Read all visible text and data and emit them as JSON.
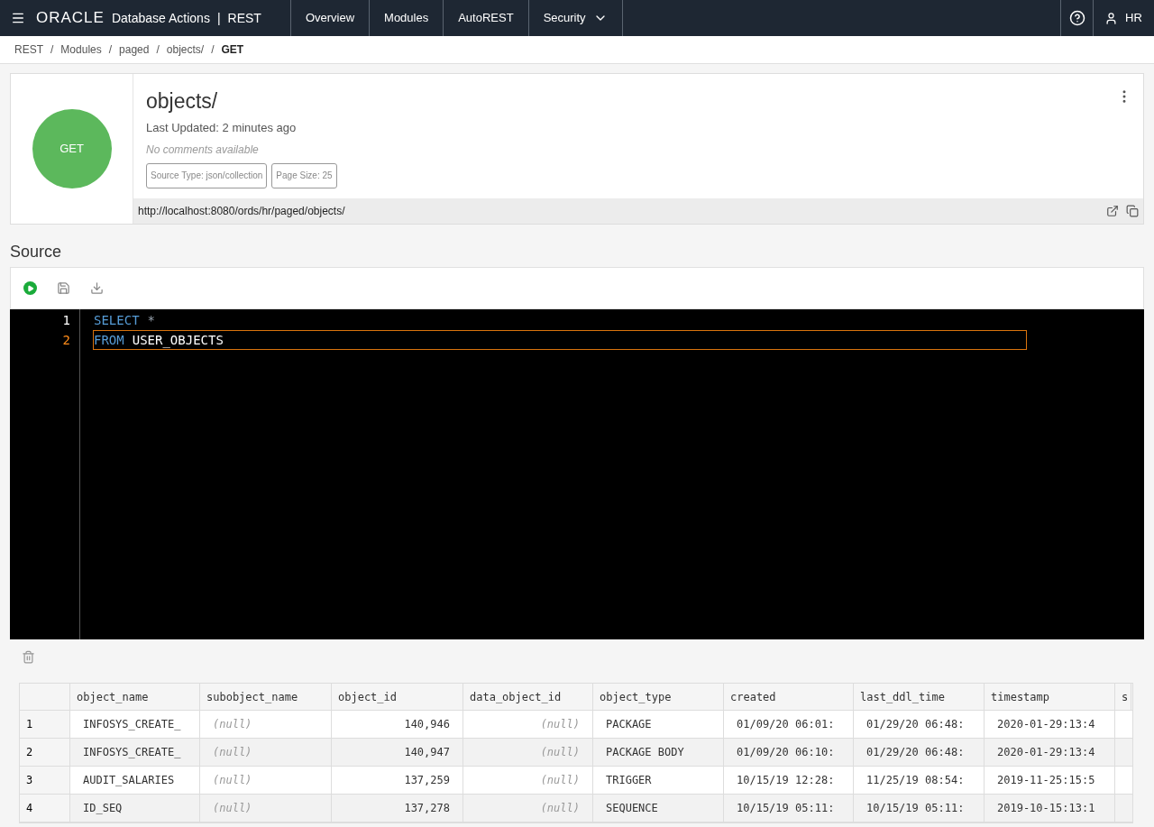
{
  "header": {
    "brand": "ORACLE",
    "app": "Database Actions",
    "separator": "|",
    "section": "REST",
    "nav": [
      {
        "label": "Overview",
        "has_menu": false
      },
      {
        "label": "Modules",
        "has_menu": false
      },
      {
        "label": "AutoREST",
        "has_menu": false
      },
      {
        "label": "Security",
        "has_menu": true
      }
    ],
    "user": "HR"
  },
  "breadcrumb": {
    "separator": "/",
    "items": [
      {
        "label": "REST",
        "current": false
      },
      {
        "label": "Modules",
        "current": false
      },
      {
        "label": "paged",
        "current": false
      },
      {
        "label": "objects/",
        "current": false
      },
      {
        "label": "GET",
        "current": true
      }
    ]
  },
  "handler": {
    "method": "GET",
    "title": "objects/",
    "updated": "Last Updated: 2 minutes ago",
    "comments": "No comments available",
    "tags": [
      "Source Type: json/collection",
      "Page Size: 25"
    ],
    "url": "http://localhost:8080/ords/hr/paged/objects/"
  },
  "source": {
    "heading": "Source",
    "lines": [
      {
        "number": "1",
        "current": false,
        "tokens": [
          {
            "kind": "keyword",
            "text": "SELECT"
          },
          {
            "kind": "operator",
            "text": "*"
          }
        ]
      },
      {
        "number": "2",
        "current": true,
        "tokens": [
          {
            "kind": "keyword",
            "text": "FROM"
          },
          {
            "kind": "ident",
            "text": "USER_OBJECTS"
          }
        ]
      }
    ]
  },
  "table": {
    "columns": [
      "object_name",
      "subobject_name",
      "object_id",
      "data_object_id",
      "object_type",
      "created",
      "last_ddl_time",
      "timestamp",
      "s"
    ],
    "rows": [
      {
        "number": "1",
        "cells": [
          "INFOSYS_CREATE_",
          "(null)",
          "140,946",
          "(null)",
          "PACKAGE",
          "01/09/20 06:01:",
          "01/29/20 06:48:",
          "2020-01-29:13:4"
        ]
      },
      {
        "number": "2",
        "cells": [
          "INFOSYS_CREATE_",
          "(null)",
          "140,947",
          "(null)",
          "PACKAGE BODY",
          "01/09/20 06:10:",
          "01/29/20 06:48:",
          "2020-01-29:13:4"
        ]
      },
      {
        "number": "3",
        "cells": [
          "AUDIT_SALARIES",
          "(null)",
          "137,259",
          "(null)",
          "TRIGGER",
          "10/15/19 12:28:",
          "11/25/19 08:54:",
          "2019-11-25:15:5"
        ]
      },
      {
        "number": "4",
        "cells": [
          "ID_SEQ",
          "(null)",
          "137,278",
          "(null)",
          "SEQUENCE",
          "10/15/19 05:11:",
          "10/15/19 05:11:",
          "2019-10-15:13:1"
        ]
      }
    ]
  }
}
